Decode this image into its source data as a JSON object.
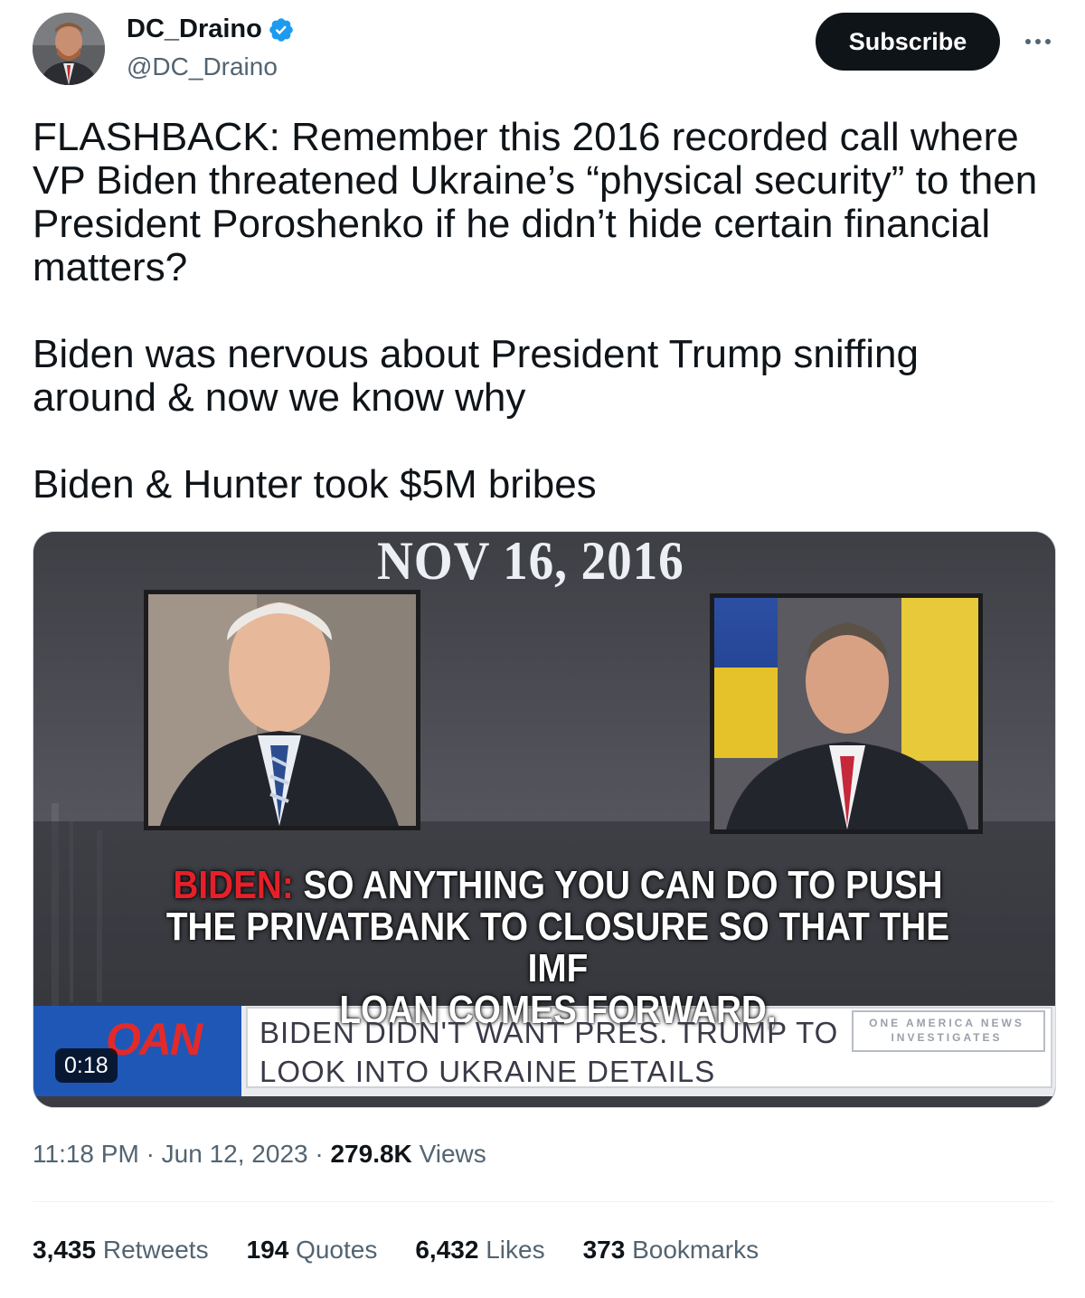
{
  "author": {
    "display_name": "DC_Draino",
    "handle": "@DC_Draino",
    "verified": true
  },
  "actions": {
    "subscribe_label": "Subscribe",
    "more_icon": "more-horizontal-icon"
  },
  "tweet": {
    "paragraphs": [
      "FLASHBACK: Remember this 2016 recorded call where VP Biden threatened Ukraine’s “physical security” to then President Poroshenko if he didn’t hide certain financial matters?",
      "Biden was nervous about President Trump sniffing around & now we know why",
      "Biden & Hunter took $5M bribes"
    ]
  },
  "video": {
    "date_overlay": "NOV 16, 2016",
    "caption_speaker": "BIDEN:",
    "caption_line1": " SO ANYTHING YOU CAN DO TO PUSH",
    "caption_line2": "THE PRIVATBANK TO CLOSURE SO THAT THE IMF",
    "caption_line3": "LOAN COMES FORWARD,",
    "network_logo": "OAN",
    "ticker_line1": "BIDEN DIDN'T WANT PRES. TRUMP TO",
    "ticker_line2": "LOOK INTO UKRAINE DETAILS",
    "side_badge_line1": "ONE AMERICA NEWS",
    "side_badge_line2": "INVESTIGATES",
    "duration": "0:18"
  },
  "meta": {
    "time": "11:18 PM",
    "separator": "·",
    "date": "Jun 12, 2023",
    "views_count": "279.8K",
    "views_label": "Views"
  },
  "stats": [
    {
      "count": "3,435",
      "label": "Retweets"
    },
    {
      "count": "194",
      "label": "Quotes"
    },
    {
      "count": "6,432",
      "label": "Likes"
    },
    {
      "count": "373",
      "label": "Bookmarks"
    }
  ],
  "colors": {
    "text_primary": "#0f1419",
    "text_secondary": "#536471",
    "verified_blue": "#1d9bf0",
    "subscribe_bg": "#0f1419"
  }
}
